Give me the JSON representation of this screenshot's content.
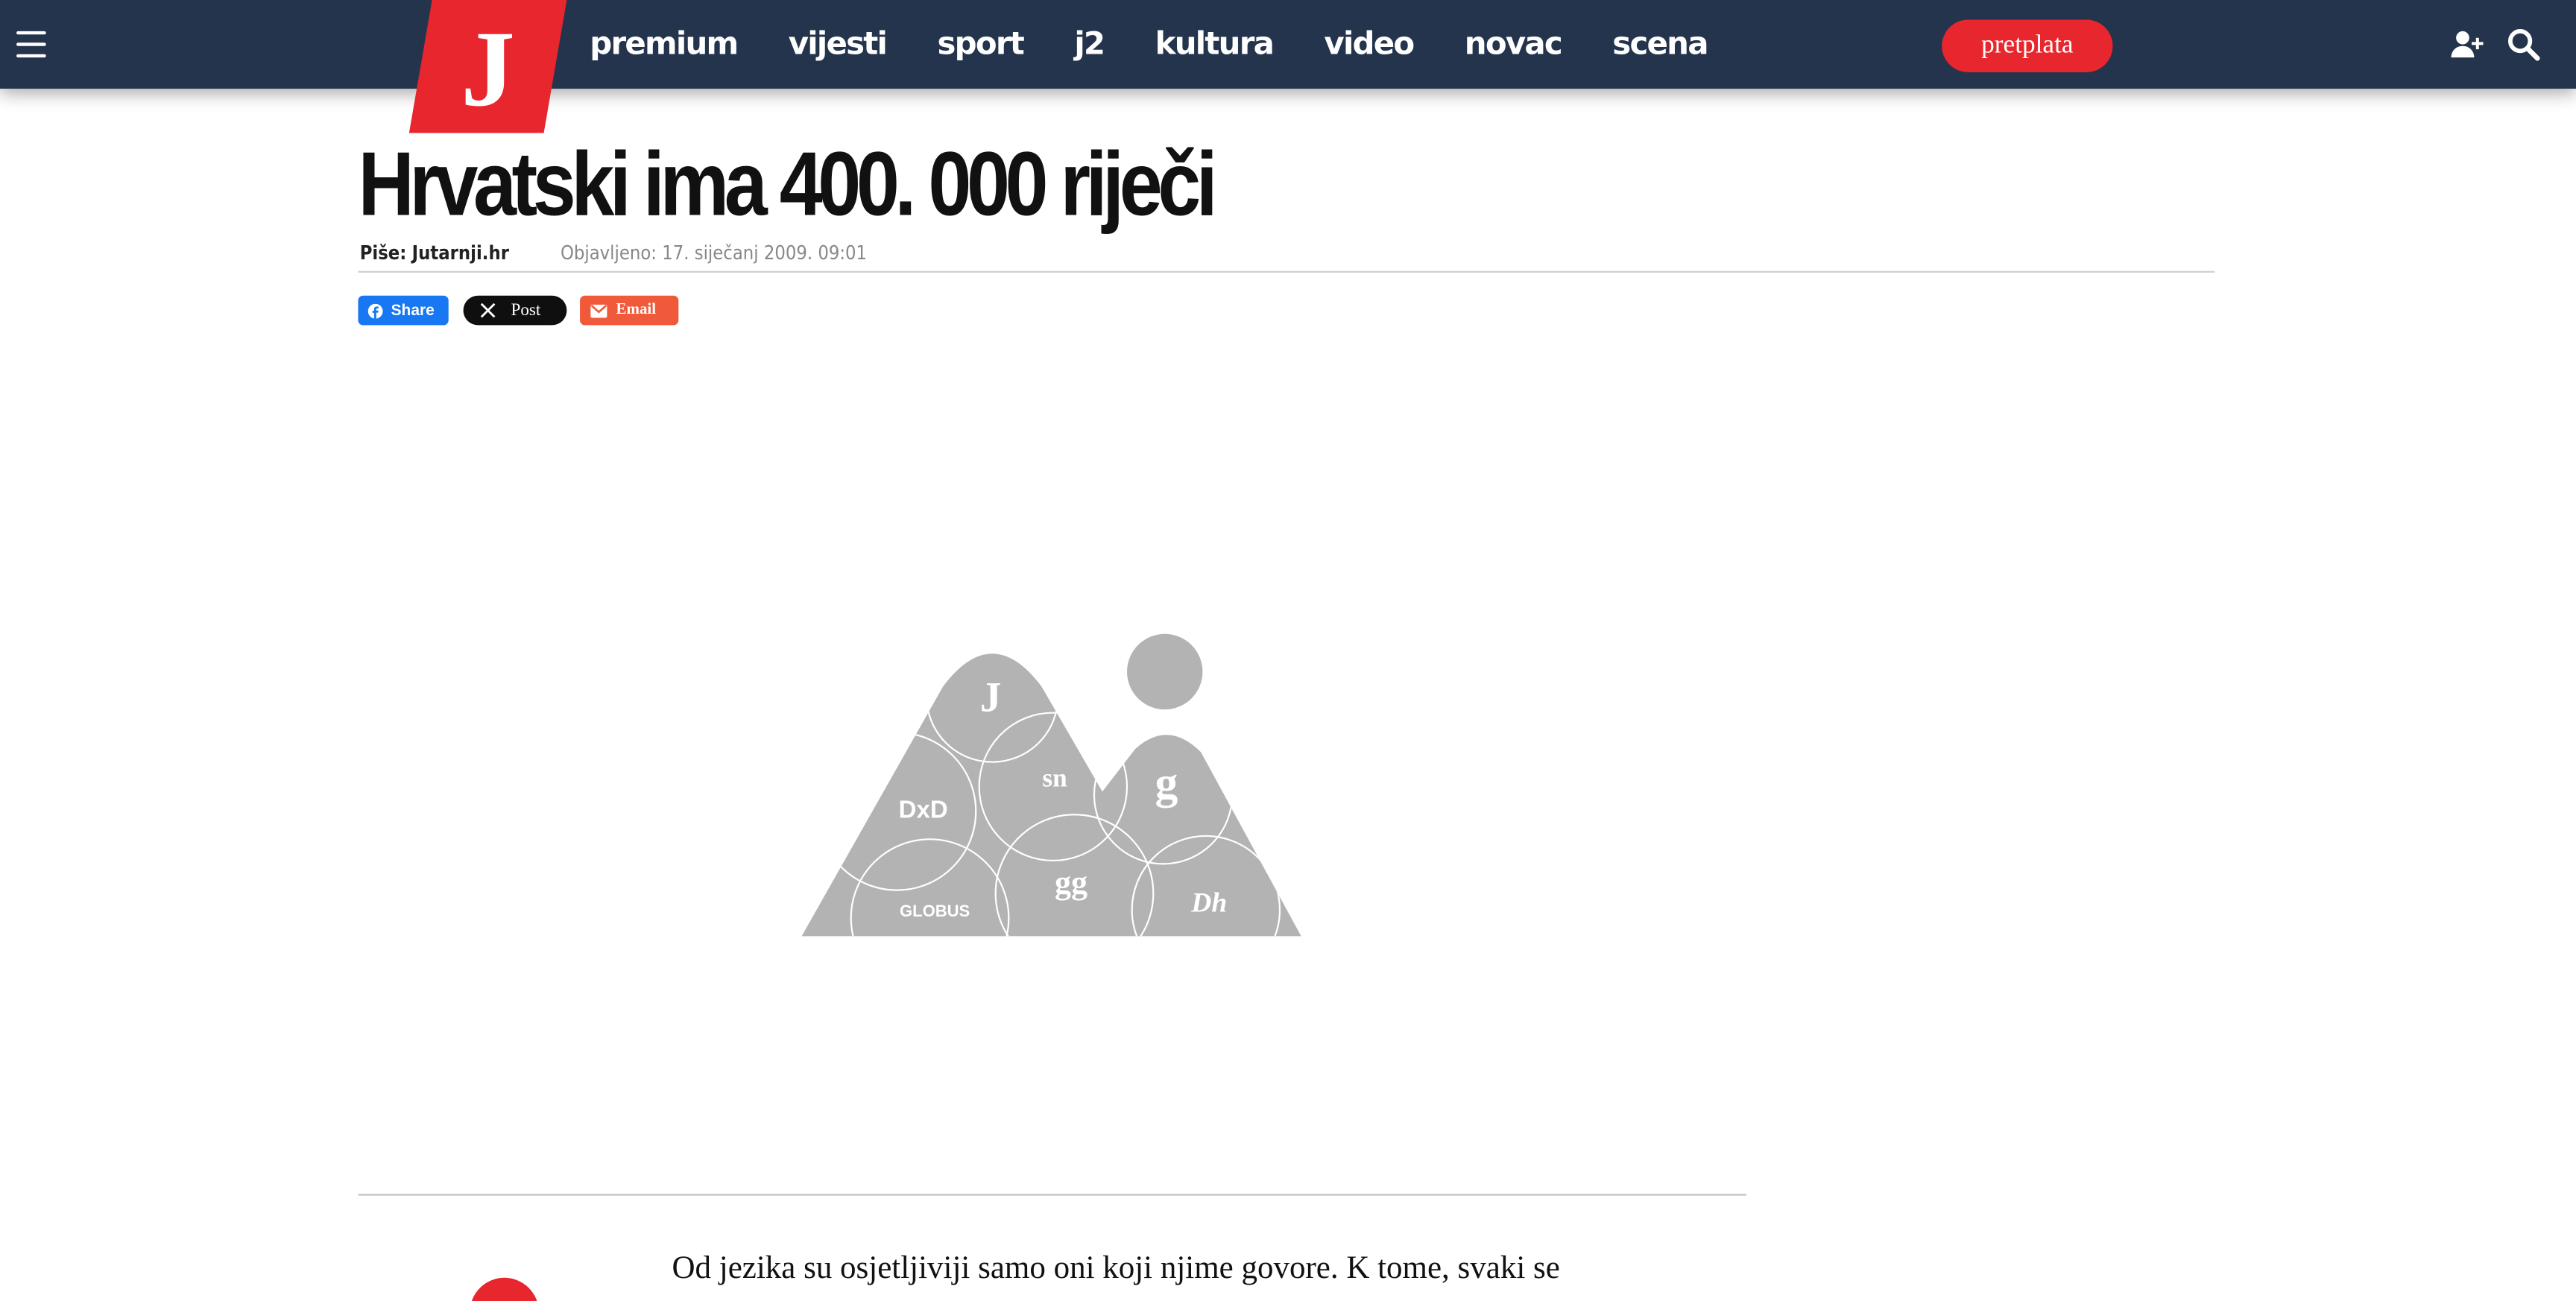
{
  "header": {
    "logo_letter": "J",
    "nav": [
      "premium",
      "vijesti",
      "sport",
      "j2",
      "kultura",
      "video",
      "novac",
      "scena"
    ],
    "subscribe_label": "pretplata",
    "colors": {
      "bar": "#24344d",
      "accent": "#e8262d"
    }
  },
  "article": {
    "title": "Hrvatski ima 400. 000 riječi",
    "author_label": "Piše:",
    "author": "Jutarnji.hr",
    "published": "Objavljeno: 17. siječanj 2009. 09:01",
    "share": {
      "facebook": "Share",
      "x": "Post",
      "email": "Email"
    },
    "image_placeholder_marks": [
      "J",
      "sn",
      "g",
      "DxD",
      "gg",
      "GLOBUS",
      "Dh"
    ],
    "lead": "Od jezika su osjetljiviji samo oni koji njime govore. K tome, svaki se"
  },
  "icons": [
    "menu-icon",
    "add-user-icon",
    "search-icon",
    "facebook-icon",
    "x-icon",
    "email-icon"
  ]
}
